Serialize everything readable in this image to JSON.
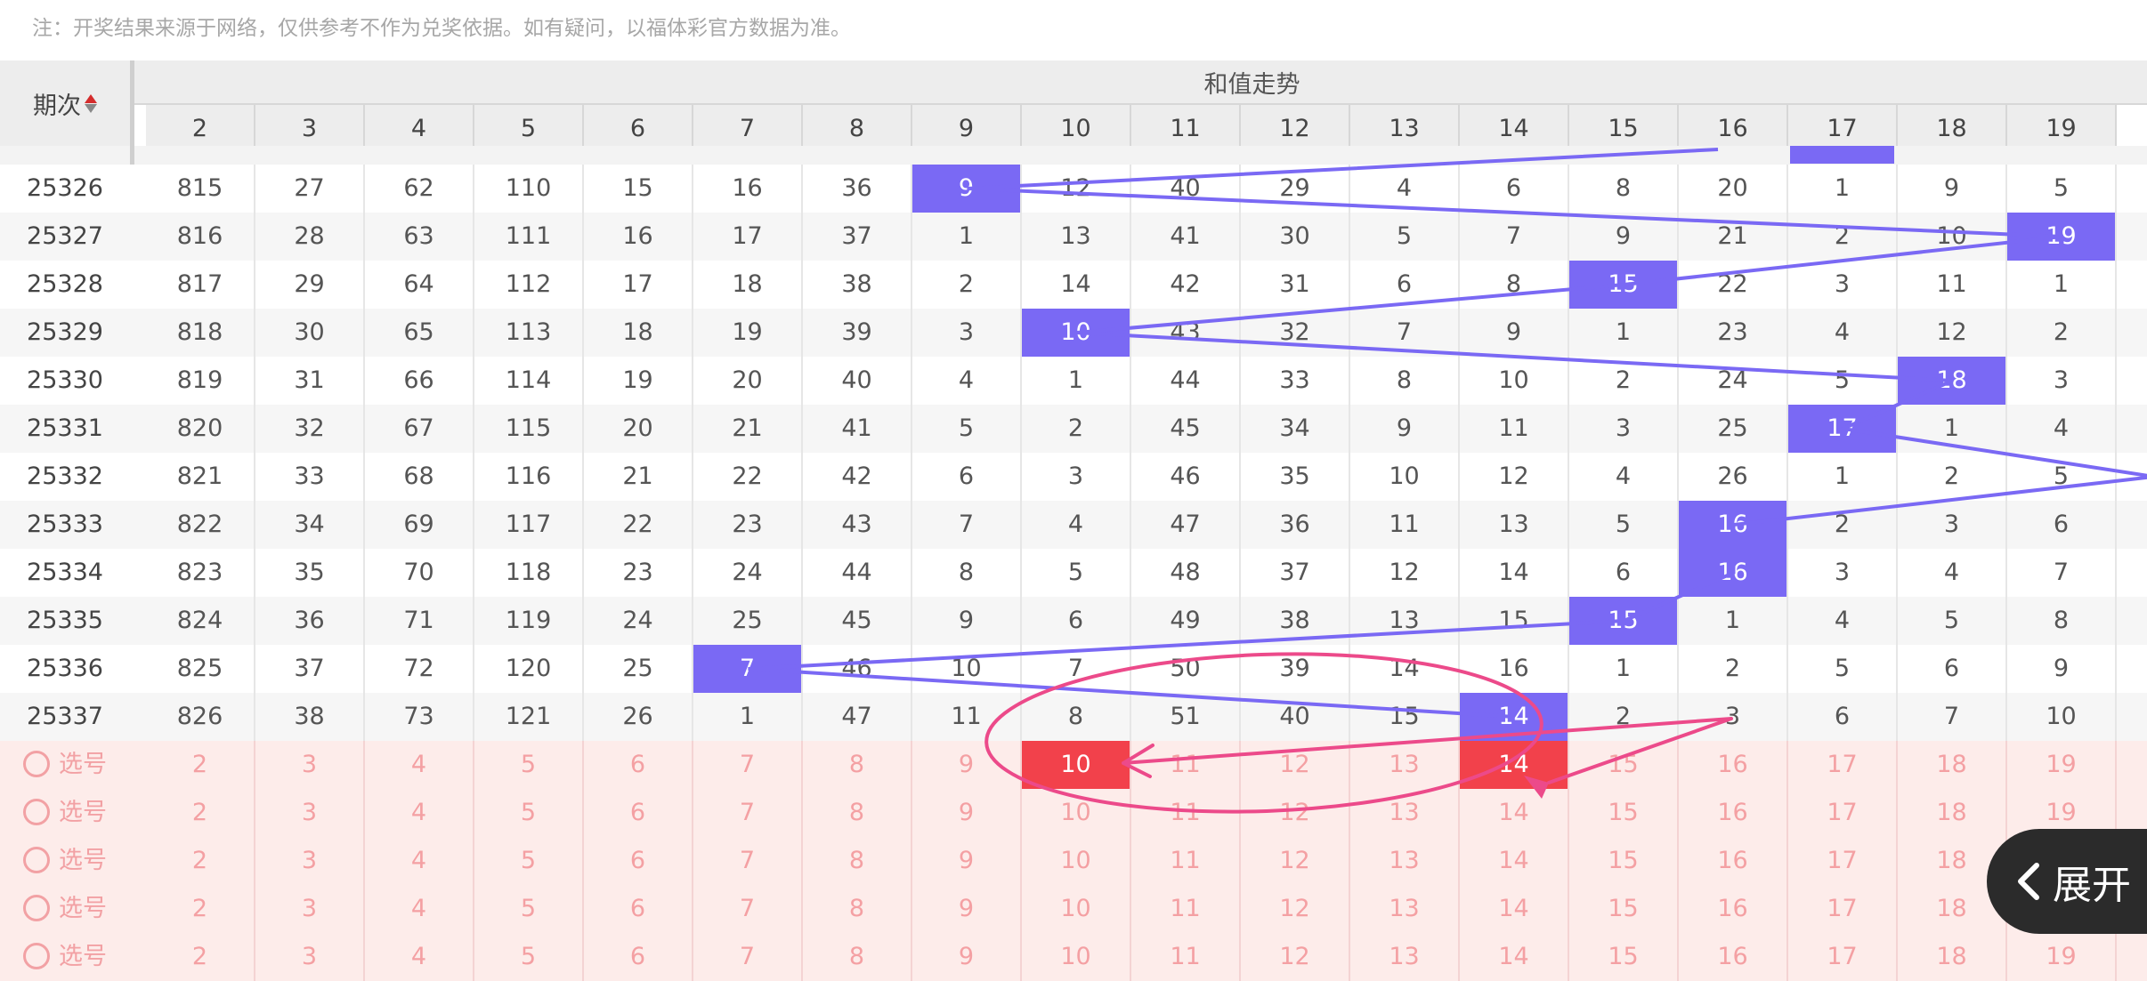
{
  "note": "注：开奖结果来源于网络，仅供参考不作为兑奖依据。如有疑问，以福体彩官方数据为准。",
  "period_header": "期次",
  "sum_header": "和值走势",
  "columns": [
    "2",
    "3",
    "4",
    "5",
    "6",
    "7",
    "8",
    "9",
    "10",
    "11",
    "12",
    "13",
    "14",
    "15",
    "16",
    "17",
    "18",
    "19"
  ],
  "rows": [
    {
      "period": "25326",
      "values": [
        "815",
        "27",
        "62",
        "110",
        "15",
        "16",
        "36",
        "9",
        "12",
        "40",
        "29",
        "4",
        "6",
        "8",
        "20",
        "1",
        "9",
        "5"
      ],
      "hit": 7
    },
    {
      "period": "25327",
      "values": [
        "816",
        "28",
        "63",
        "111",
        "16",
        "17",
        "37",
        "1",
        "13",
        "41",
        "30",
        "5",
        "7",
        "9",
        "21",
        "2",
        "10",
        "19"
      ],
      "hit": 17
    },
    {
      "period": "25328",
      "values": [
        "817",
        "29",
        "64",
        "112",
        "17",
        "18",
        "38",
        "2",
        "14",
        "42",
        "31",
        "6",
        "8",
        "15",
        "22",
        "3",
        "11",
        "1"
      ],
      "hit": 13
    },
    {
      "period": "25329",
      "values": [
        "818",
        "30",
        "65",
        "113",
        "18",
        "19",
        "39",
        "3",
        "10",
        "43",
        "32",
        "7",
        "9",
        "1",
        "23",
        "4",
        "12",
        "2"
      ],
      "hit": 8
    },
    {
      "period": "25330",
      "values": [
        "819",
        "31",
        "66",
        "114",
        "19",
        "20",
        "40",
        "4",
        "1",
        "44",
        "33",
        "8",
        "10",
        "2",
        "24",
        "5",
        "18",
        "3"
      ],
      "hit": 16
    },
    {
      "period": "25331",
      "values": [
        "820",
        "32",
        "67",
        "115",
        "20",
        "21",
        "41",
        "5",
        "2",
        "45",
        "34",
        "9",
        "11",
        "3",
        "25",
        "17",
        "1",
        "4"
      ],
      "hit": 15
    },
    {
      "period": "25332",
      "values": [
        "821",
        "33",
        "68",
        "116",
        "21",
        "22",
        "42",
        "6",
        "3",
        "46",
        "35",
        "10",
        "12",
        "4",
        "26",
        "1",
        "2",
        "5"
      ],
      "hit": -1
    },
    {
      "period": "25333",
      "values": [
        "822",
        "34",
        "69",
        "117",
        "22",
        "23",
        "43",
        "7",
        "4",
        "47",
        "36",
        "11",
        "13",
        "5",
        "16",
        "2",
        "3",
        "6"
      ],
      "hit": 14
    },
    {
      "period": "25334",
      "values": [
        "823",
        "35",
        "70",
        "118",
        "23",
        "24",
        "44",
        "8",
        "5",
        "48",
        "37",
        "12",
        "14",
        "6",
        "16",
        "3",
        "4",
        "7"
      ],
      "hit": 14
    },
    {
      "period": "25335",
      "values": [
        "824",
        "36",
        "71",
        "119",
        "24",
        "25",
        "45",
        "9",
        "6",
        "49",
        "38",
        "13",
        "15",
        "15",
        "1",
        "4",
        "5",
        "8"
      ],
      "hit": 13
    },
    {
      "period": "25336",
      "values": [
        "825",
        "37",
        "72",
        "120",
        "25",
        "7",
        "46",
        "10",
        "7",
        "50",
        "39",
        "14",
        "16",
        "1",
        "2",
        "5",
        "6",
        "9"
      ],
      "hit": 5
    },
    {
      "period": "25337",
      "values": [
        "826",
        "38",
        "73",
        "121",
        "26",
        "1",
        "47",
        "11",
        "8",
        "51",
        "40",
        "15",
        "14",
        "2",
        "3",
        "6",
        "7",
        "10"
      ],
      "hit": 12
    }
  ],
  "select_label": "选号",
  "select_values": [
    "2",
    "3",
    "4",
    "5",
    "6",
    "7",
    "8",
    "9",
    "10",
    "11",
    "12",
    "13",
    "14",
    "15",
    "16",
    "17",
    "18",
    "19"
  ],
  "select_rows": 5,
  "expand_label": "展开",
  "colors": {
    "highlight": "#7a69f4",
    "selected_red": "#f2414b",
    "select_bg": "#fdecea",
    "annotation": "#ec4a8a"
  }
}
